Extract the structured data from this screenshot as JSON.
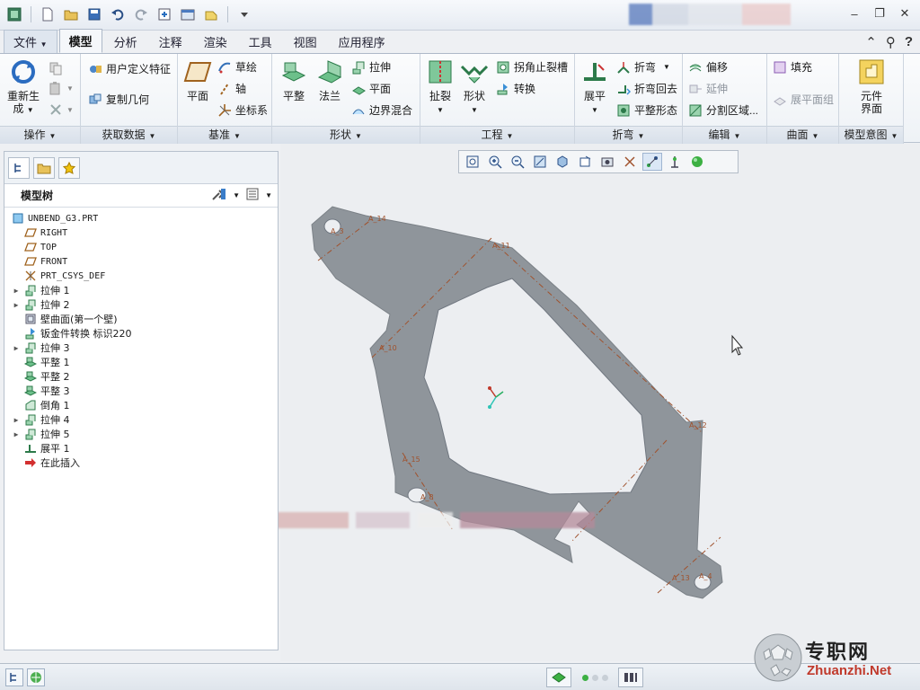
{
  "quick_access": {
    "icons": [
      "app-icon",
      "new-icon",
      "open-icon",
      "save-icon",
      "undo-icon",
      "redo-icon",
      "regenerate-icon",
      "windows-icon",
      "close-window-icon",
      "customize-icon"
    ]
  },
  "tabs": [
    "文件",
    "模型",
    "分析",
    "注释",
    "渲染",
    "工具",
    "视图",
    "应用程序"
  ],
  "active_tab": "模型",
  "ribbon": {
    "operations": {
      "label": "操作",
      "regenerate": "重新生\n成",
      "regenerate_line1": "重新生",
      "regenerate_line2": "成"
    },
    "get_data": {
      "label": "获取数据",
      "udf": "用户定义特征",
      "copy_geom": "复制几何"
    },
    "datum": {
      "label": "基准",
      "plane": "平面",
      "sketch": "草绘",
      "axis": "轴",
      "csys": "坐标系"
    },
    "shapes": {
      "label": "形状",
      "planar": "平整",
      "flange": "法兰",
      "extrude": "拉伸",
      "flat": "平面",
      "blend": "边界混合"
    },
    "engineering": {
      "label": "工程",
      "rip": "扯裂",
      "form": "形状",
      "corner_relief": "拐角止裂槽",
      "convert": "转换"
    },
    "bends": {
      "label": "折弯",
      "unbend": "展平",
      "bend": "折弯",
      "bend_back": "折弯回去",
      "flatten_form": "平整形态"
    },
    "editing": {
      "label": "编辑",
      "offset": "偏移",
      "extend": "延伸",
      "split_area": "分割区域..."
    },
    "surfaces": {
      "label": "曲面",
      "fill": "填充",
      "flat_quilt": "展平面组"
    },
    "model_intent": {
      "label": "模型意图",
      "component_interface": "元件\n界面",
      "ci_line1": "元件",
      "ci_line2": "界面"
    }
  },
  "model_tree": {
    "title": "模型树",
    "items": [
      {
        "label": "UNBEND_G3.PRT",
        "icon": "part-icon",
        "expandable": false,
        "indent": 0
      },
      {
        "label": "RIGHT",
        "icon": "datum-plane-icon",
        "expandable": false,
        "indent": 1
      },
      {
        "label": "TOP",
        "icon": "datum-plane-icon",
        "expandable": false,
        "indent": 1
      },
      {
        "label": "FRONT",
        "icon": "datum-plane-icon",
        "expandable": false,
        "indent": 1
      },
      {
        "label": "PRT_CSYS_DEF",
        "icon": "csys-icon",
        "expandable": false,
        "indent": 1
      },
      {
        "label": "拉伸 1",
        "icon": "extrude-icon",
        "expandable": true,
        "indent": 1
      },
      {
        "label": "拉伸 2",
        "icon": "extrude-icon",
        "expandable": true,
        "indent": 1
      },
      {
        "label": "壁曲面(第一个壁)",
        "icon": "wall-icon",
        "expandable": false,
        "indent": 1
      },
      {
        "label": "钣金件转换 标识220",
        "icon": "convert-icon",
        "expandable": false,
        "indent": 1
      },
      {
        "label": "拉伸 3",
        "icon": "extrude-icon",
        "expandable": true,
        "indent": 1
      },
      {
        "label": "平整 1",
        "icon": "planar-icon",
        "expandable": false,
        "indent": 1
      },
      {
        "label": "平整 2",
        "icon": "planar-icon",
        "expandable": false,
        "indent": 1
      },
      {
        "label": "平整 3",
        "icon": "planar-icon",
        "expandable": false,
        "indent": 1
      },
      {
        "label": "倒角 1",
        "icon": "chamfer-icon",
        "expandable": false,
        "indent": 1
      },
      {
        "label": "拉伸 4",
        "icon": "extrude-icon",
        "expandable": true,
        "indent": 1
      },
      {
        "label": "拉伸 5",
        "icon": "extrude-icon",
        "expandable": true,
        "indent": 1
      },
      {
        "label": "展平 1",
        "icon": "unbend-icon",
        "expandable": false,
        "indent": 1
      },
      {
        "label": "在此插入",
        "icon": "insert-here-icon",
        "expandable": false,
        "indent": 1
      }
    ]
  },
  "graphics": {
    "bend_labels": [
      "A_14",
      "A_3",
      "A_11",
      "A_10",
      "A_12",
      "A_15",
      "A_8",
      "A_13",
      "A_4"
    ]
  },
  "colors": {
    "part_fill": "#8f959b",
    "bend_line": "#a0522d",
    "graphics_bg": "#eceef1",
    "accent": "#2f6fb3"
  },
  "watermark": {
    "title": "专职网",
    "url": "Zhuanzhi.Net"
  }
}
